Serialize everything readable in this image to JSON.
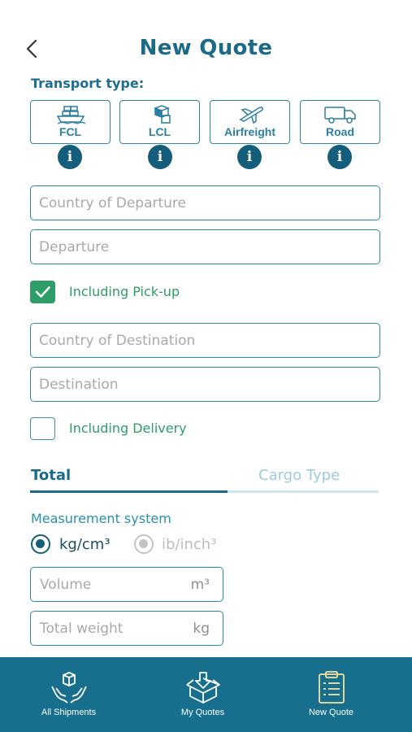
{
  "header": {
    "title": "New Quote"
  },
  "transport": {
    "label": "Transport type:",
    "options": [
      {
        "label": "FCL",
        "icon": "ship-icon"
      },
      {
        "label": "LCL",
        "icon": "boxes-icon"
      },
      {
        "label": "Airfreight",
        "icon": "airplane-icon"
      },
      {
        "label": "Road",
        "icon": "truck-icon"
      }
    ],
    "info_glyph": "i"
  },
  "form": {
    "country_departure_placeholder": "Country of Departure",
    "departure_placeholder": "Departure",
    "pickup_label": "Including Pick-up",
    "pickup_checked": true,
    "country_destination_placeholder": "Country of Destination",
    "destination_placeholder": "Destination",
    "delivery_label": "Including Delivery",
    "delivery_checked": false
  },
  "tabs": {
    "total": "Total",
    "cargo": "Cargo Type"
  },
  "measurement": {
    "label": "Measurement system",
    "option_metric": "kg/cm³",
    "option_imperial": "ib/inch³",
    "selected": "kg/cm³"
  },
  "volume": {
    "placeholder": "Volume",
    "unit": "m³"
  },
  "weight": {
    "placeholder": "Total weight",
    "unit": "kg"
  },
  "bottom_nav": [
    {
      "label": "All Shipments",
      "icon": "hands-box-icon"
    },
    {
      "label": "My Quotes",
      "icon": "open-box-icon"
    },
    {
      "label": "New Quote",
      "icon": "clipboard-icon",
      "active": true
    }
  ],
  "colors": {
    "primary": "#1b6a88",
    "accent_green": "#2e9d67",
    "nav_bg": "#176f8d",
    "nav_active": "#f3e3a2"
  }
}
